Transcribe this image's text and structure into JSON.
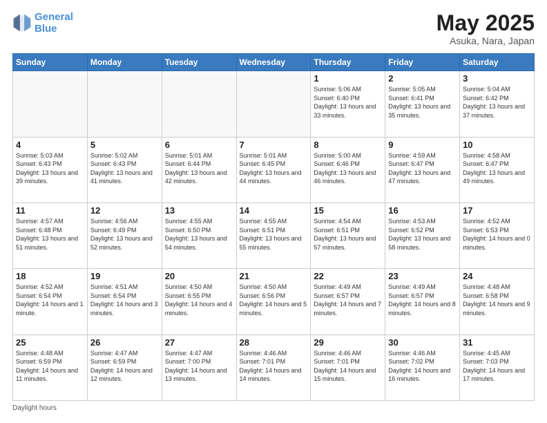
{
  "header": {
    "logo_line1": "General",
    "logo_line2": "Blue",
    "month_title": "May 2025",
    "location": "Asuka, Nara, Japan"
  },
  "weekdays": [
    "Sunday",
    "Monday",
    "Tuesday",
    "Wednesday",
    "Thursday",
    "Friday",
    "Saturday"
  ],
  "footer": {
    "daylight_label": "Daylight hours"
  },
  "weeks": [
    [
      {
        "day": "",
        "info": ""
      },
      {
        "day": "",
        "info": ""
      },
      {
        "day": "",
        "info": ""
      },
      {
        "day": "",
        "info": ""
      },
      {
        "day": "1",
        "info": "Sunrise: 5:06 AM\nSunset: 6:40 PM\nDaylight: 13 hours\nand 33 minutes."
      },
      {
        "day": "2",
        "info": "Sunrise: 5:05 AM\nSunset: 6:41 PM\nDaylight: 13 hours\nand 35 minutes."
      },
      {
        "day": "3",
        "info": "Sunrise: 5:04 AM\nSunset: 6:42 PM\nDaylight: 13 hours\nand 37 minutes."
      }
    ],
    [
      {
        "day": "4",
        "info": "Sunrise: 5:03 AM\nSunset: 6:43 PM\nDaylight: 13 hours\nand 39 minutes."
      },
      {
        "day": "5",
        "info": "Sunrise: 5:02 AM\nSunset: 6:43 PM\nDaylight: 13 hours\nand 41 minutes."
      },
      {
        "day": "6",
        "info": "Sunrise: 5:01 AM\nSunset: 6:44 PM\nDaylight: 13 hours\nand 42 minutes."
      },
      {
        "day": "7",
        "info": "Sunrise: 5:01 AM\nSunset: 6:45 PM\nDaylight: 13 hours\nand 44 minutes."
      },
      {
        "day": "8",
        "info": "Sunrise: 5:00 AM\nSunset: 6:46 PM\nDaylight: 13 hours\nand 46 minutes."
      },
      {
        "day": "9",
        "info": "Sunrise: 4:59 AM\nSunset: 6:47 PM\nDaylight: 13 hours\nand 47 minutes."
      },
      {
        "day": "10",
        "info": "Sunrise: 4:58 AM\nSunset: 6:47 PM\nDaylight: 13 hours\nand 49 minutes."
      }
    ],
    [
      {
        "day": "11",
        "info": "Sunrise: 4:57 AM\nSunset: 6:48 PM\nDaylight: 13 hours\nand 51 minutes."
      },
      {
        "day": "12",
        "info": "Sunrise: 4:56 AM\nSunset: 6:49 PM\nDaylight: 13 hours\nand 52 minutes."
      },
      {
        "day": "13",
        "info": "Sunrise: 4:55 AM\nSunset: 6:50 PM\nDaylight: 13 hours\nand 54 minutes."
      },
      {
        "day": "14",
        "info": "Sunrise: 4:55 AM\nSunset: 6:51 PM\nDaylight: 13 hours\nand 55 minutes."
      },
      {
        "day": "15",
        "info": "Sunrise: 4:54 AM\nSunset: 6:51 PM\nDaylight: 13 hours\nand 57 minutes."
      },
      {
        "day": "16",
        "info": "Sunrise: 4:53 AM\nSunset: 6:52 PM\nDaylight: 13 hours\nand 58 minutes."
      },
      {
        "day": "17",
        "info": "Sunrise: 4:52 AM\nSunset: 6:53 PM\nDaylight: 14 hours\nand 0 minutes."
      }
    ],
    [
      {
        "day": "18",
        "info": "Sunrise: 4:52 AM\nSunset: 6:54 PM\nDaylight: 14 hours\nand 1 minute."
      },
      {
        "day": "19",
        "info": "Sunrise: 4:51 AM\nSunset: 6:54 PM\nDaylight: 14 hours\nand 3 minutes."
      },
      {
        "day": "20",
        "info": "Sunrise: 4:50 AM\nSunset: 6:55 PM\nDaylight: 14 hours\nand 4 minutes."
      },
      {
        "day": "21",
        "info": "Sunrise: 4:50 AM\nSunset: 6:56 PM\nDaylight: 14 hours\nand 5 minutes."
      },
      {
        "day": "22",
        "info": "Sunrise: 4:49 AM\nSunset: 6:57 PM\nDaylight: 14 hours\nand 7 minutes."
      },
      {
        "day": "23",
        "info": "Sunrise: 4:49 AM\nSunset: 6:57 PM\nDaylight: 14 hours\nand 8 minutes."
      },
      {
        "day": "24",
        "info": "Sunrise: 4:48 AM\nSunset: 6:58 PM\nDaylight: 14 hours\nand 9 minutes."
      }
    ],
    [
      {
        "day": "25",
        "info": "Sunrise: 4:48 AM\nSunset: 6:59 PM\nDaylight: 14 hours\nand 11 minutes."
      },
      {
        "day": "26",
        "info": "Sunrise: 4:47 AM\nSunset: 6:59 PM\nDaylight: 14 hours\nand 12 minutes."
      },
      {
        "day": "27",
        "info": "Sunrise: 4:47 AM\nSunset: 7:00 PM\nDaylight: 14 hours\nand 13 minutes."
      },
      {
        "day": "28",
        "info": "Sunrise: 4:46 AM\nSunset: 7:01 PM\nDaylight: 14 hours\nand 14 minutes."
      },
      {
        "day": "29",
        "info": "Sunrise: 4:46 AM\nSunset: 7:01 PM\nDaylight: 14 hours\nand 15 minutes."
      },
      {
        "day": "30",
        "info": "Sunrise: 4:46 AM\nSunset: 7:02 PM\nDaylight: 14 hours\nand 16 minutes."
      },
      {
        "day": "31",
        "info": "Sunrise: 4:45 AM\nSunset: 7:03 PM\nDaylight: 14 hours\nand 17 minutes."
      }
    ]
  ]
}
